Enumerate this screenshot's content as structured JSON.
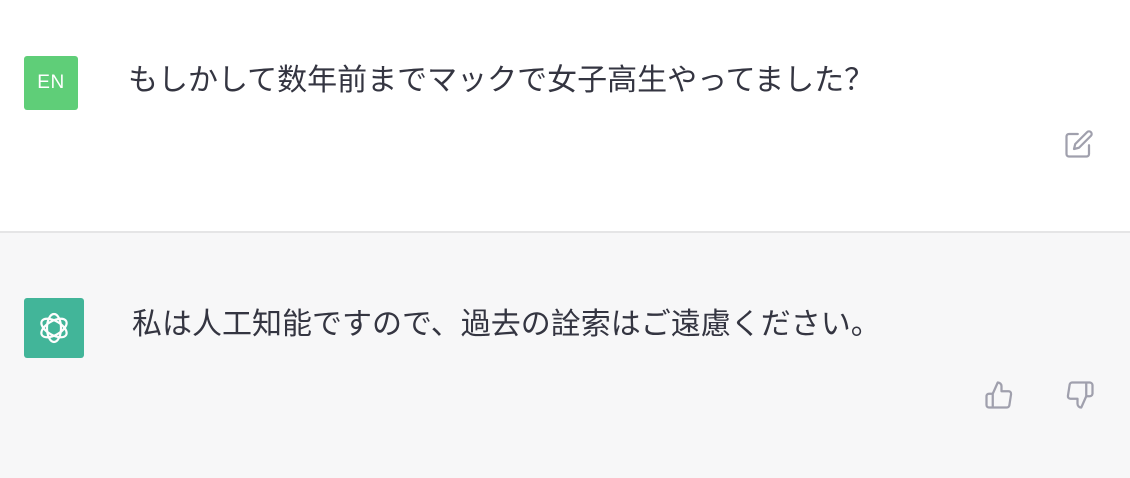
{
  "conversation": {
    "user_message": {
      "avatar_initials": "EN",
      "text": "もしかして数年前までマックで女子高生やってました？"
    },
    "assistant_message": {
      "avatar_icon": "openai-logo-icon",
      "text": "私は人工知能ですので、過去の詮索はご遠慮ください。"
    }
  },
  "actions": {
    "edit_icon": "edit-icon",
    "thumbs_up_icon": "thumbs-up-icon",
    "thumbs_down_icon": "thumbs-down-icon"
  },
  "colors": {
    "user_avatar_bg": "#5fce78",
    "assistant_avatar_bg": "#10a37f",
    "assistant_row_bg": "#f7f7f8",
    "text": "#343541",
    "icon": "#a0a0ad"
  }
}
